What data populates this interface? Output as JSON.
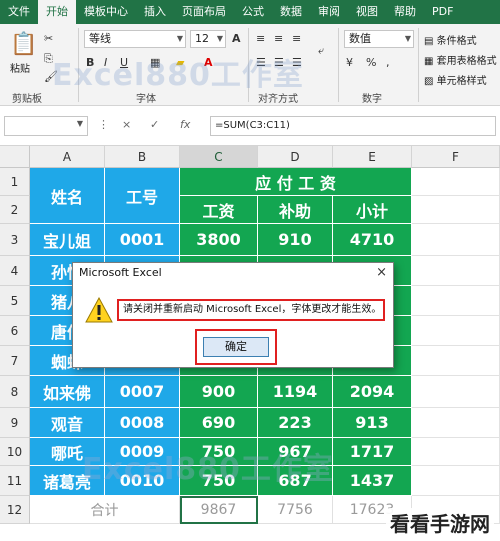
{
  "ribbon": {
    "tabs": [
      "文件",
      "开始",
      "模板中心",
      "插入",
      "页面布局",
      "公式",
      "数据",
      "审阅",
      "视图",
      "帮助",
      "PDF"
    ],
    "active_tab_index": 1,
    "font_name": "等线",
    "font_size": "12",
    "number_format": "数值",
    "paste_label": "粘贴",
    "clipboard_label": "剪贴板",
    "font_group_label": "字体",
    "align_group_label": "对齐方式",
    "number_group_label": "数字",
    "conditional_format": "条件格式",
    "table_format": "套用表格格式",
    "cell_style": "单元格样式",
    "watermark_text": "Excel880工作室"
  },
  "formula_bar": {
    "name_box": "",
    "formula": "=SUM(C3:C11)",
    "cancel_icon": "×",
    "enter_icon": "✓",
    "fx_label": "fx"
  },
  "grid": {
    "columns": [
      "A",
      "B",
      "C",
      "D",
      "E",
      "F"
    ],
    "rows": [
      "1",
      "2",
      "3",
      "4",
      "5",
      "6",
      "7",
      "8",
      "9",
      "10",
      "11",
      "12"
    ],
    "header": {
      "name": "姓名",
      "id": "工号",
      "pay": "应 付 工 资",
      "salary": "工资",
      "subsidy": "补助",
      "subtotal": "小计"
    },
    "data_rows": [
      {
        "name": "宝儿姐",
        "id": "0001",
        "salary": "3800",
        "subsidy": "910",
        "subtotal": "4710"
      },
      {
        "name": "孙悟",
        "id": "",
        "salary": "",
        "subsidy": "",
        "subtotal": ""
      },
      {
        "name": "猪八",
        "id": "",
        "salary": "",
        "subsidy": "",
        "subtotal": ""
      },
      {
        "name": "唐僧",
        "id": "",
        "salary": "",
        "subsidy": "",
        "subtotal": ""
      },
      {
        "name": "蜘蛛",
        "id": "",
        "salary": "",
        "subsidy": "",
        "subtotal": ""
      },
      {
        "name": "如来佛",
        "id": "0007",
        "salary": "900",
        "subsidy": "1194",
        "subtotal": "2094"
      },
      {
        "name": "观音",
        "id": "0008",
        "salary": "690",
        "subsidy": "223",
        "subtotal": "913"
      },
      {
        "name": "哪吒",
        "id": "0009",
        "salary": "750",
        "subsidy": "967",
        "subtotal": "1717"
      },
      {
        "name": "诸葛亮",
        "id": "0010",
        "salary": "750",
        "subsidy": "687",
        "subtotal": "1437"
      }
    ],
    "total_row": {
      "label": "合计",
      "salary": "9867",
      "subsidy": "7756",
      "subtotal": "17623"
    },
    "grid_watermark": "Excel880工作室"
  },
  "dialog": {
    "title": "Microsoft Excel",
    "close": "×",
    "message": "请关闭并重新启动 Microsoft Excel，字体更改才能生效。",
    "ok_label": "确定"
  },
  "badge": "看看手游网",
  "colors": {
    "excel_green": "#217346",
    "header_blue": "#1fa8e8",
    "header_green": "#13a651",
    "highlight_red": "#e02020"
  }
}
